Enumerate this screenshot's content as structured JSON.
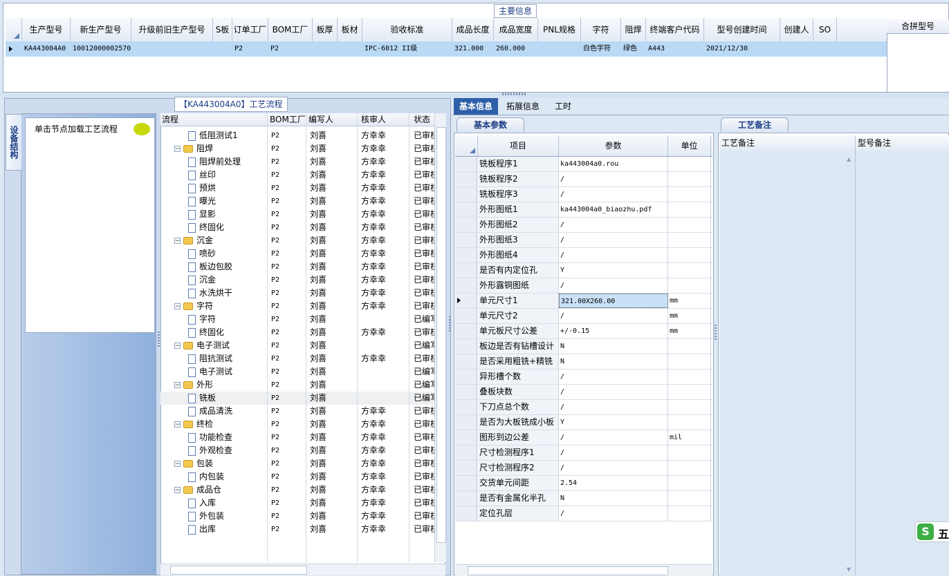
{
  "top": {
    "title": "主要信息",
    "columns": [
      "生产型号",
      "新生产型号",
      "升级前旧生产型号",
      "S板",
      "订单工厂",
      "BOM工厂",
      "板厚",
      "板材",
      "验收标准",
      "成品长度",
      "成品宽度",
      "PNL规格",
      "字符",
      "阻焊",
      "终端客户代码",
      "型号创建时间",
      "创建人",
      "SO"
    ],
    "row": [
      "KA443004A0",
      "10012000002570",
      "",
      "",
      "P2",
      "P2",
      "",
      "",
      "IPC-6012 II级",
      "321.000",
      "260.000",
      "",
      "白色字符",
      "绿色",
      "A443",
      "2021/12/30",
      "",
      ""
    ],
    "merge_header": "合拼型号"
  },
  "left": {
    "vtab": "设备结构",
    "hint": "单击节点加载工艺流程",
    "flow_title": "【KA443004A0】工艺流程",
    "tree_columns": [
      "流程",
      "BOM工厂",
      "编写人",
      "核审人",
      "状态"
    ],
    "tree_rows": [
      {
        "type": "leaf",
        "name": "低阻测试1",
        "bom": "P2",
        "writer": "刘喜",
        "reviewer": "方幸幸",
        "status": "已审核"
      },
      {
        "type": "group",
        "name": "阻焊",
        "bom": "P2",
        "writer": "刘喜",
        "reviewer": "方幸幸",
        "status": "已审核"
      },
      {
        "type": "leaf",
        "name": "阻焊前处理",
        "bom": "P2",
        "writer": "刘喜",
        "reviewer": "方幸幸",
        "status": "已审核"
      },
      {
        "type": "leaf",
        "name": "丝印",
        "bom": "P2",
        "writer": "刘喜",
        "reviewer": "方幸幸",
        "status": "已审核"
      },
      {
        "type": "leaf",
        "name": "预烘",
        "bom": "P2",
        "writer": "刘喜",
        "reviewer": "方幸幸",
        "status": "已审核"
      },
      {
        "type": "leaf",
        "name": "曝光",
        "bom": "P2",
        "writer": "刘喜",
        "reviewer": "方幸幸",
        "status": "已审核"
      },
      {
        "type": "leaf",
        "name": "显影",
        "bom": "P2",
        "writer": "刘喜",
        "reviewer": "方幸幸",
        "status": "已审核"
      },
      {
        "type": "leaf",
        "name": "终固化",
        "bom": "P2",
        "writer": "刘喜",
        "reviewer": "方幸幸",
        "status": "已审核"
      },
      {
        "type": "group",
        "name": "沉金",
        "bom": "P2",
        "writer": "刘喜",
        "reviewer": "方幸幸",
        "status": "已审核"
      },
      {
        "type": "leaf",
        "name": "喷砂",
        "bom": "P2",
        "writer": "刘喜",
        "reviewer": "方幸幸",
        "status": "已审核"
      },
      {
        "type": "leaf",
        "name": "板边包胶",
        "bom": "P2",
        "writer": "刘喜",
        "reviewer": "方幸幸",
        "status": "已审核"
      },
      {
        "type": "leaf",
        "name": "沉金",
        "bom": "P2",
        "writer": "刘喜",
        "reviewer": "方幸幸",
        "status": "已审核"
      },
      {
        "type": "leaf",
        "name": "水洗烘干",
        "bom": "P2",
        "writer": "刘喜",
        "reviewer": "方幸幸",
        "status": "已审核"
      },
      {
        "type": "group",
        "name": "字符",
        "bom": "P2",
        "writer": "刘喜",
        "reviewer": "方幸幸",
        "status": "已审核"
      },
      {
        "type": "leaf",
        "name": "字符",
        "bom": "P2",
        "writer": "刘喜",
        "reviewer": "",
        "status": "已编写"
      },
      {
        "type": "leaf",
        "name": "终固化",
        "bom": "P2",
        "writer": "刘喜",
        "reviewer": "方幸幸",
        "status": "已审核"
      },
      {
        "type": "group",
        "name": "电子测试",
        "bom": "P2",
        "writer": "刘喜",
        "reviewer": "",
        "status": "已编写"
      },
      {
        "type": "leaf",
        "name": "阻抗测试",
        "bom": "P2",
        "writer": "刘喜",
        "reviewer": "方幸幸",
        "status": "已审核"
      },
      {
        "type": "leaf",
        "name": "电子测试",
        "bom": "P2",
        "writer": "刘喜",
        "reviewer": "",
        "status": "已编写"
      },
      {
        "type": "group",
        "name": "外形",
        "bom": "P2",
        "writer": "刘喜",
        "reviewer": "",
        "status": "已编写"
      },
      {
        "type": "leaf",
        "name": "铣板",
        "bom": "P2",
        "writer": "刘喜",
        "reviewer": "",
        "status": "已编写"
      },
      {
        "type": "leaf",
        "name": "成品清洗",
        "bom": "P2",
        "writer": "刘喜",
        "reviewer": "方幸幸",
        "status": "已审核"
      },
      {
        "type": "group",
        "name": "终检",
        "bom": "P2",
        "writer": "刘喜",
        "reviewer": "方幸幸",
        "status": "已审核"
      },
      {
        "type": "leaf",
        "name": "功能检查",
        "bom": "P2",
        "writer": "刘喜",
        "reviewer": "方幸幸",
        "status": "已审核"
      },
      {
        "type": "leaf",
        "name": "外观检查",
        "bom": "P2",
        "writer": "刘喜",
        "reviewer": "方幸幸",
        "status": "已审核"
      },
      {
        "type": "group",
        "name": "包装",
        "bom": "P2",
        "writer": "刘喜",
        "reviewer": "方幸幸",
        "status": "已审核"
      },
      {
        "type": "leaf",
        "name": "内包装",
        "bom": "P2",
        "writer": "刘喜",
        "reviewer": "方幸幸",
        "status": "已审核"
      },
      {
        "type": "group",
        "name": "成品仓",
        "bom": "P2",
        "writer": "刘喜",
        "reviewer": "方幸幸",
        "status": "已审核"
      },
      {
        "type": "leaf",
        "name": "入库",
        "bom": "P2",
        "writer": "刘喜",
        "reviewer": "方幸幸",
        "status": "已审核"
      },
      {
        "type": "leaf",
        "name": "外包装",
        "bom": "P2",
        "writer": "刘喜",
        "reviewer": "方幸幸",
        "status": "已审核"
      },
      {
        "type": "leaf",
        "name": "出库",
        "bom": "P2",
        "writer": "刘喜",
        "reviewer": "方幸幸",
        "status": "已审核"
      }
    ]
  },
  "right": {
    "tabs": [
      "基本信息",
      "拓展信息",
      "工时"
    ],
    "param_title": "基本参数",
    "param_columns": [
      "项目",
      "参数",
      "单位"
    ],
    "params": [
      {
        "name": "铣板程序1",
        "value": "ka443004a0.rou",
        "unit": ""
      },
      {
        "name": "铣板程序2",
        "value": "/",
        "unit": ""
      },
      {
        "name": "铣板程序3",
        "value": "/",
        "unit": ""
      },
      {
        "name": "外形图纸1",
        "value": "ka443004a0_biaozhu.pdf",
        "unit": ""
      },
      {
        "name": "外形图纸2",
        "value": "/",
        "unit": ""
      },
      {
        "name": "外形图纸3",
        "value": "/",
        "unit": ""
      },
      {
        "name": "外形图纸4",
        "value": "/",
        "unit": ""
      },
      {
        "name": "是否有内定位孔",
        "value": "Y",
        "unit": ""
      },
      {
        "name": "外形露铜图纸",
        "value": "/",
        "unit": ""
      },
      {
        "name": "单元尺寸1",
        "value": "321.00X260.00",
        "unit": "mm"
      },
      {
        "name": "单元尺寸2",
        "value": "/",
        "unit": "mm"
      },
      {
        "name": "单元板尺寸公差",
        "value": "+/-0.15",
        "unit": "mm"
      },
      {
        "name": "板边是否有钻槽设计",
        "value": "N",
        "unit": ""
      },
      {
        "name": "是否采用粗铣+精铣",
        "value": "N",
        "unit": ""
      },
      {
        "name": "异形槽个数",
        "value": "/",
        "unit": ""
      },
      {
        "name": "叠板块数",
        "value": "/",
        "unit": ""
      },
      {
        "name": "下刀点总个数",
        "value": "/",
        "unit": ""
      },
      {
        "name": "是否为大板铣成小板",
        "value": "Y",
        "unit": ""
      },
      {
        "name": "图形到边公差",
        "value": "/",
        "unit": "mil"
      },
      {
        "name": "尺寸检测程序1",
        "value": "/",
        "unit": ""
      },
      {
        "name": "尺寸检测程序2",
        "value": "/",
        "unit": ""
      },
      {
        "name": "交货单元间距",
        "value": "2.54",
        "unit": ""
      },
      {
        "name": "是否有金属化半孔",
        "value": "N",
        "unit": ""
      },
      {
        "name": "定位孔层",
        "value": "/",
        "unit": ""
      }
    ],
    "note_title": "工艺备注",
    "note_columns": [
      "工艺备注",
      "型号备注"
    ]
  },
  "ime": {
    "logo": "S",
    "text": "五"
  }
}
